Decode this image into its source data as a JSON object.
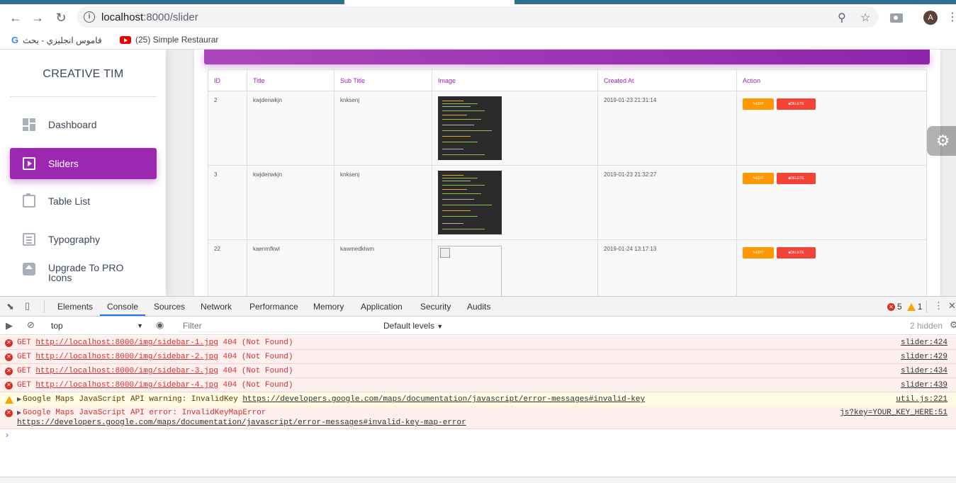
{
  "browser": {
    "url_host": "localhost",
    "url_path": ":8000/slider",
    "avatar_letter": "A",
    "bookmarks": [
      {
        "label": "قاموس انجليزي - بحث"
      },
      {
        "label": "(25) Simple Restaurar"
      }
    ]
  },
  "sidebar": {
    "brand": "CREATIVE TIM",
    "items": [
      {
        "label": "Dashboard",
        "icon": "dashboard-icon",
        "active": false
      },
      {
        "label": "Sliders",
        "icon": "play-box-icon",
        "active": true
      },
      {
        "label": "Table List",
        "icon": "clipboard-icon",
        "active": false
      },
      {
        "label": "Typography",
        "icon": "library-books-icon",
        "active": false
      },
      {
        "label": "Upgrade To PRO Icons",
        "icon": "upgrade-icon",
        "active": false
      }
    ],
    "accent_color": "#9c27b0"
  },
  "table": {
    "headers": [
      "ID",
      "Title",
      "Sub Title",
      "Image",
      "Created At",
      "Action"
    ],
    "rows": [
      {
        "id": "2",
        "title": "kwjdenwkjn",
        "subtitle": "knksenj",
        "image": "code-screenshot",
        "created_at": "2019-01-23 21:31:14"
      },
      {
        "id": "3",
        "title": "kwjdenwkjn",
        "subtitle": "knksenj",
        "image": "code-screenshot",
        "created_at": "2019-01-23 21:32:27"
      },
      {
        "id": "22",
        "title": "kaenmfkwl",
        "subtitle": "kawmedklwm",
        "image": "broken-image",
        "created_at": "2019-01-24 13:17:13"
      }
    ],
    "edit_label": "Edit",
    "delete_label": "Delete"
  },
  "devtools": {
    "tabs": [
      "Elements",
      "Console",
      "Sources",
      "Network",
      "Performance",
      "Memory",
      "Application",
      "Security",
      "Audits"
    ],
    "active_tab": "Console",
    "error_count": "5",
    "warning_count": "1",
    "context": "top",
    "filter_placeholder": "Filter",
    "levels": "Default levels",
    "hidden": "2 hidden",
    "messages": [
      {
        "level": "error",
        "method": "GET",
        "url": "http://localhost:8000/img/sidebar-1.jpg",
        "status": "404 (Not Found)",
        "source": "slider:424"
      },
      {
        "level": "error",
        "method": "GET",
        "url": "http://localhost:8000/img/sidebar-2.jpg",
        "status": "404 (Not Found)",
        "source": "slider:429"
      },
      {
        "level": "error",
        "method": "GET",
        "url": "http://localhost:8000/img/sidebar-3.jpg",
        "status": "404 (Not Found)",
        "source": "slider:434"
      },
      {
        "level": "error",
        "method": "GET",
        "url": "http://localhost:8000/img/sidebar-4.jpg",
        "status": "404 (Not Found)",
        "source": "slider:439"
      },
      {
        "level": "warning",
        "text": "Google Maps JavaScript API warning: InvalidKey",
        "url": "https://developers.google.com/maps/documentation/javascript/error-messages#invalid-key",
        "source": "util.js:221"
      },
      {
        "level": "error",
        "text": "Google Maps JavaScript API error: InvalidKeyMapError",
        "url": "https://developers.google.com/maps/documentation/javascript/error-messages#invalid-key-map-error",
        "source": "js?key=YOUR_KEY_HERE:51"
      }
    ]
  }
}
